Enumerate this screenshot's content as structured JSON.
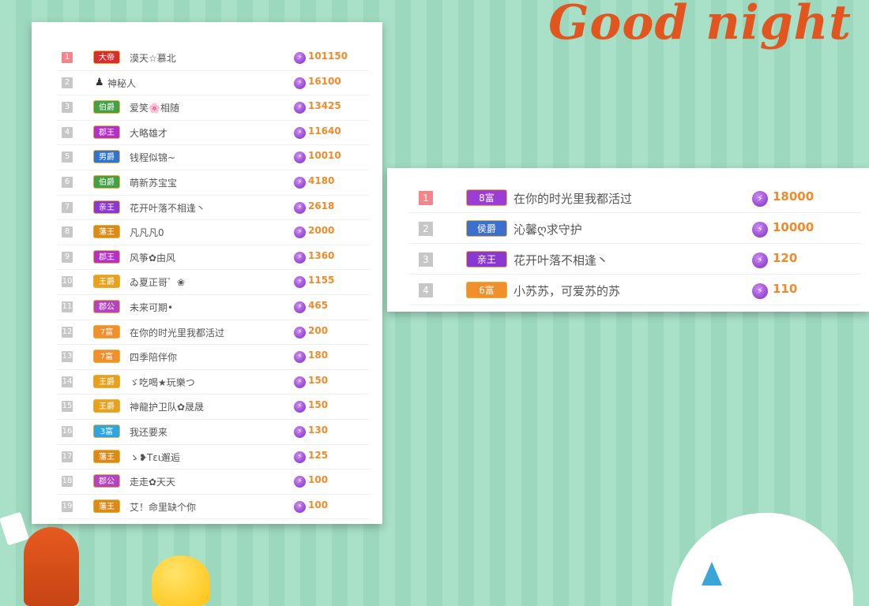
{
  "title": "Good night",
  "left_ranking": [
    {
      "rank": "1",
      "badge": "大帝",
      "badge_color": "#d72f2f",
      "name": "漠天☆慕北",
      "score": "101150"
    },
    {
      "rank": "2",
      "badge": "",
      "badge_color": "",
      "name": "神秘人",
      "score": "16100"
    },
    {
      "rank": "3",
      "badge": "伯爵",
      "badge_color": "#43a047",
      "name": "爱笑🌸相随",
      "score": "13425"
    },
    {
      "rank": "4",
      "badge": "郡王",
      "badge_color": "#b52fc9",
      "name": "大略雄才",
      "score": "11640"
    },
    {
      "rank": "5",
      "badge": "男爵",
      "badge_color": "#2f74d0",
      "name": "钱程似锦~",
      "score": "10010"
    },
    {
      "rank": "6",
      "badge": "伯爵",
      "badge_color": "#43a047",
      "name": "萌新苏宝宝",
      "score": "4180"
    },
    {
      "rank": "7",
      "badge": "亲王",
      "badge_color": "#8a37d4",
      "name": "花开叶落不相逢丶",
      "score": "2618"
    },
    {
      "rank": "8",
      "badge": "藩王",
      "badge_color": "#d98a18",
      "name": "凡凡凡0",
      "score": "2000"
    },
    {
      "rank": "9",
      "badge": "郡王",
      "badge_color": "#b52fc9",
      "name": "风筝✿由风",
      "score": "1360"
    },
    {
      "rank": "10",
      "badge": "王爵",
      "badge_color": "#e6a21e",
      "name": "ゐ夏正哥゛❀",
      "score": "1155"
    },
    {
      "rank": "11",
      "badge": "郡公",
      "badge_color": "#b343c2",
      "name": "未来可期•",
      "score": "465"
    },
    {
      "rank": "12",
      "badge": "7富",
      "badge_color": "#f18f2d",
      "name": "在你的时光里我都活过",
      "score": "200"
    },
    {
      "rank": "13",
      "badge": "7富",
      "badge_color": "#f18f2d",
      "name": "四季陪伴你",
      "score": "180"
    },
    {
      "rank": "14",
      "badge": "王爵",
      "badge_color": "#e6a21e",
      "name": "ゞ吃喝★玩樂つ",
      "score": "150"
    },
    {
      "rank": "15",
      "badge": "王爵",
      "badge_color": "#e6a21e",
      "name": "神龍护卫队✿晟晟",
      "score": "150"
    },
    {
      "rank": "16",
      "badge": "3富",
      "badge_color": "#2aa6e4",
      "name": "我还要来",
      "score": "130"
    },
    {
      "rank": "17",
      "badge": "藩王",
      "badge_color": "#d98a18",
      "name": "ゝ❥Tει邂逅",
      "score": "125"
    },
    {
      "rank": "18",
      "badge": "郡公",
      "badge_color": "#b343c2",
      "name": "走走✿天天",
      "score": "100"
    },
    {
      "rank": "19",
      "badge": "藩王",
      "badge_color": "#d98a18",
      "name": "艾！命里缺个你",
      "score": "100"
    }
  ],
  "right_ranking": [
    {
      "rank": "1",
      "badge": "8富",
      "badge_color": "#9c3dd6",
      "name": "在你的时光里我都活过",
      "score": "18000"
    },
    {
      "rank": "2",
      "badge": "侯爵",
      "badge_color": "#3b6fd0",
      "name": "沁馨ღ求守护",
      "score": "10000"
    },
    {
      "rank": "3",
      "badge": "亲王",
      "badge_color": "#8a37d4",
      "name": "花开叶落不相逢丶",
      "score": "120"
    },
    {
      "rank": "4",
      "badge": "6富",
      "badge_color": "#f18f2d",
      "name": "小苏苏，可爱苏的苏",
      "score": "110"
    }
  ],
  "coin_icon": "lightning-coin-icon",
  "colors": {
    "accent_score": "#f08a2a",
    "rank_top": "#f2868b",
    "rank_other": "#c7c7c7"
  }
}
